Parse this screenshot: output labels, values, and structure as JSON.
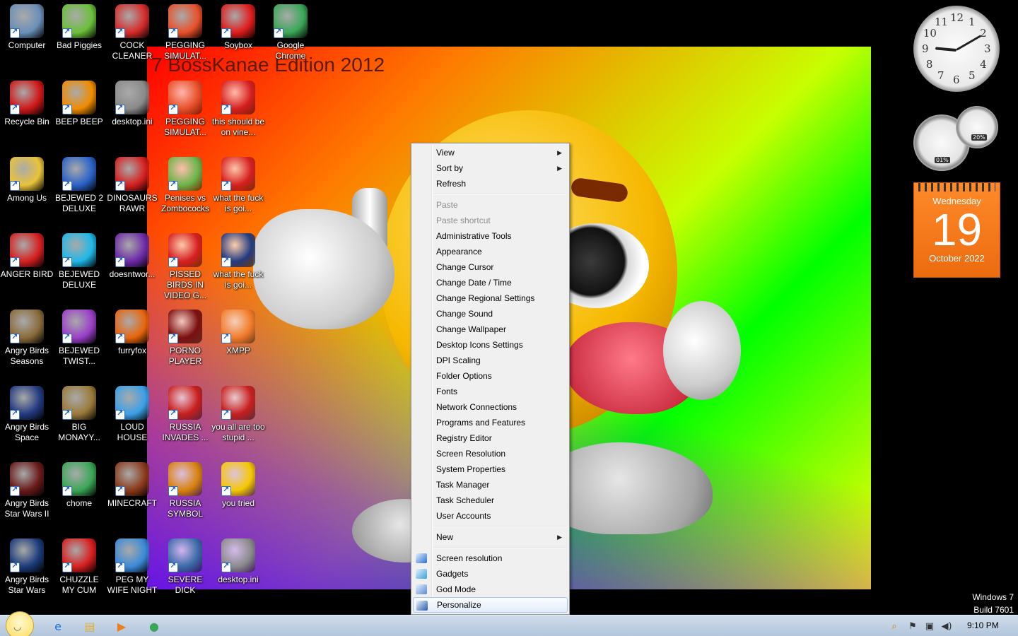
{
  "wallpaper": {
    "title": "7 BossKanae Edition 2012"
  },
  "desktop_icons": [
    {
      "label": "Computer",
      "icon": "computer-icon",
      "color": "#6a8fb8"
    },
    {
      "label": "Bad Piggies",
      "icon": "bad-piggies-icon",
      "color": "#6bbf3a"
    },
    {
      "label": "COCK CLEANER",
      "icon": "ccleaner-icon",
      "color": "#d62b2b"
    },
    {
      "label": "PEGGING SIMULAT...",
      "icon": "pegging-icon",
      "color": "#e8502a"
    },
    {
      "label": "Soybox",
      "icon": "soybox-icon",
      "color": "#e01c1c"
    },
    {
      "label": "Google Chrome",
      "icon": "chrome-icon",
      "color": "#3aa757"
    },
    {
      "label": "Recycle Bin",
      "icon": "recycle-bin-icon",
      "color": "#d01818"
    },
    {
      "label": "BEEP BEEP",
      "icon": "vlc-icon",
      "color": "#f08c00"
    },
    {
      "label": "desktop.ini",
      "icon": "ini-file-icon",
      "color": "#8a8a8a"
    },
    {
      "label": "PEGGING SIMULAT...",
      "icon": "pegging-icon",
      "color": "#e8502a"
    },
    {
      "label": "this should be on vine...",
      "icon": "angry-bird-icon",
      "color": "#d61f1f"
    },
    {
      "label": "Among Us",
      "icon": "among-us-icon",
      "color": "#e9c33a"
    },
    {
      "label": "BEJEWED 2 DELUXE",
      "icon": "bejeweled-icon",
      "color": "#2a62c9"
    },
    {
      "label": "DINOSAURS RAWR",
      "icon": "angry-bird-icon",
      "color": "#d61f1f"
    },
    {
      "label": "Penises vs Zombococks",
      "icon": "pvz-icon",
      "color": "#6bb34a"
    },
    {
      "label": "what the fuck is goi...",
      "icon": "angry-bird-icon",
      "color": "#d61f1f"
    },
    {
      "label": "ANGER BIRD",
      "icon": "angry-bird-icon",
      "color": "#d61f1f"
    },
    {
      "label": "BEJEWED DELUXE",
      "icon": "gem-icon",
      "color": "#1fb8e8"
    },
    {
      "label": "doesntwor...",
      "icon": "yahoo-icon",
      "color": "#6d2aa8"
    },
    {
      "label": "PISSED BIRDS IN VIDEO G...",
      "icon": "angry-bird-icon",
      "color": "#d61f1f"
    },
    {
      "label": "what the fuck is goi...",
      "icon": "angry-birds-space-icon",
      "color": "#233a80"
    },
    {
      "label": "Angry Birds Seasons",
      "icon": "angry-birds-seasons-icon",
      "color": "#8a6b3a"
    },
    {
      "label": "BEJEWED TWIST...",
      "icon": "bejeweled-twist-icon",
      "color": "#9a3fc9"
    },
    {
      "label": "furryfox",
      "icon": "firefox-icon",
      "color": "#e8650c"
    },
    {
      "label": "PORNO PLAYER",
      "icon": "flash-player-icon",
      "color": "#7a0f0f"
    },
    {
      "label": "XMPP",
      "icon": "xampp-icon",
      "color": "#f27b2a"
    },
    {
      "label": "Angry Birds Space",
      "icon": "angry-birds-space-icon",
      "color": "#233a80"
    },
    {
      "label": "BIG MONAYY...",
      "icon": "money-bag-icon",
      "color": "#9a7a3a"
    },
    {
      "label": "LOUD HOUSE",
      "icon": "loud-house-icon",
      "color": "#3aa0e8"
    },
    {
      "label": "RUSSIA INVADES ...",
      "icon": "radiation-icon",
      "color": "#c81e1e"
    },
    {
      "label": "you all are too stupid ...",
      "icon": "dev-cpp-icon",
      "color": "#c81e1e"
    },
    {
      "label": "Angry Birds Star Wars II",
      "icon": "angry-birds-sw2-icon",
      "color": "#6a1a1a"
    },
    {
      "label": "chome",
      "icon": "chrome-icon",
      "color": "#3aa757"
    },
    {
      "label": "MINECRAFT",
      "icon": "minecraft-icon",
      "color": "#8b3a1a"
    },
    {
      "label": "RUSSIA SYMBOL",
      "icon": "block-icon",
      "color": "#d8820c"
    },
    {
      "label": "you tried",
      "icon": "star-icon",
      "color": "#f5c800"
    },
    {
      "label": "Angry Birds Star Wars",
      "icon": "angry-birds-sw-icon",
      "color": "#1a3a7a"
    },
    {
      "label": "CHUZZLE MY CUM",
      "icon": "chuzzle-icon",
      "color": "#d81e1e"
    },
    {
      "label": "PEG MY WIFE NIGHT",
      "icon": "pegging-icon",
      "color": "#3a8ad8"
    },
    {
      "label": "SEVERE DICK",
      "icon": "sd-gear-icon",
      "color": "#3a6aa8"
    },
    {
      "label": "desktop.ini",
      "icon": "ini-file-icon",
      "color": "#8a8a8a"
    }
  ],
  "context_menu": {
    "items": [
      {
        "label": "View",
        "submenu": true
      },
      {
        "label": "Sort by",
        "submenu": true
      },
      {
        "label": "Refresh"
      },
      {
        "sep": true
      },
      {
        "label": "Paste",
        "disabled": true
      },
      {
        "label": "Paste shortcut",
        "disabled": true
      },
      {
        "label": "Administrative Tools"
      },
      {
        "label": "Appearance"
      },
      {
        "label": "Change Cursor"
      },
      {
        "label": "Change Date / Time"
      },
      {
        "label": "Change Regional Settings"
      },
      {
        "label": "Change Sound"
      },
      {
        "label": "Change Wallpaper"
      },
      {
        "label": "Desktop Icons Settings"
      },
      {
        "label": "DPI Scaling"
      },
      {
        "label": "Folder Options"
      },
      {
        "label": "Fonts"
      },
      {
        "label": "Network Connections"
      },
      {
        "label": "Programs and Features"
      },
      {
        "label": "Registry Editor"
      },
      {
        "label": "Screen Resolution"
      },
      {
        "label": "System Properties"
      },
      {
        "label": "Task Manager"
      },
      {
        "label": "Task Scheduler"
      },
      {
        "label": "User Accounts"
      },
      {
        "sep": true
      },
      {
        "label": "New",
        "submenu": true
      },
      {
        "sep": true
      },
      {
        "label": "Screen resolution",
        "icon": "screen-resolution-icon"
      },
      {
        "label": "Gadgets",
        "icon": "gadgets-icon"
      },
      {
        "label": "God Mode",
        "icon": "god-mode-icon"
      },
      {
        "label": "Personalize",
        "icon": "personalize-icon",
        "highlighted": true
      }
    ]
  },
  "gadgets": {
    "calendar": {
      "weekday": "Wednesday",
      "day": "19",
      "month_year": "October 2022"
    },
    "meter": {
      "cpu": "01%",
      "ram": "20%"
    },
    "clock_numbers": [
      "12",
      "1",
      "2",
      "3",
      "4",
      "5",
      "6",
      "7",
      "8",
      "9",
      "10",
      "11"
    ]
  },
  "system_info": {
    "line1": "Windows 7",
    "line2": "Build 7601"
  },
  "taskbar": {
    "pinned": [
      {
        "name": "ie-icon",
        "glyph": "e",
        "color": "#1e6fd9"
      },
      {
        "name": "explorer-icon",
        "glyph": "▤",
        "color": "#e0b030"
      },
      {
        "name": "media-player-icon",
        "glyph": "▶",
        "color": "#e8801c"
      },
      {
        "name": "chrome-icon",
        "glyph": "●",
        "color": "#3aa757"
      }
    ],
    "time": "9:10 PM"
  }
}
